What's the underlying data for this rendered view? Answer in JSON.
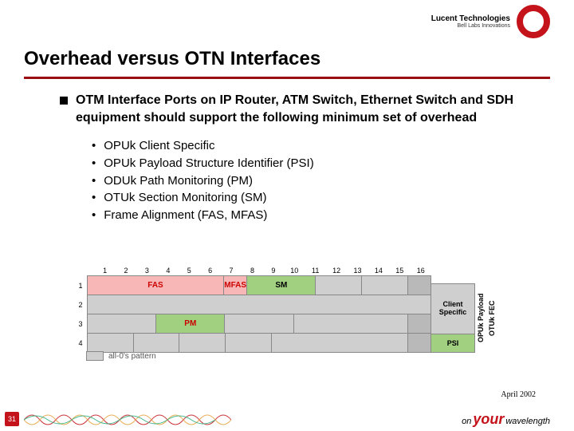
{
  "brand": {
    "name": "Lucent Technologies",
    "tag": "Bell Labs Innovations"
  },
  "title": "Overhead versus OTN Interfaces",
  "main_bullet": "OTM Interface Ports on IP Router, ATM Switch, Ethernet Switch and SDH equipment should support the following minimum set of overhead",
  "sub_bullets": [
    "OPUk Client Specific",
    "OPUk Payload Structure Identifier (PSI)",
    "ODUk Path Monitoring (PM)",
    "OTUk Section Monitoring (SM)",
    "Frame Alignment (FAS, MFAS)"
  ],
  "table": {
    "cols": [
      "1",
      "2",
      "3",
      "4",
      "5",
      "6",
      "7",
      "8",
      "9",
      "10",
      "11",
      "12",
      "13",
      "14",
      "15",
      "16"
    ],
    "rows": [
      "1",
      "2",
      "3",
      "4"
    ],
    "labels": {
      "fas": "FAS",
      "mfas": "MFAS",
      "sm": "SM",
      "pm": "PM",
      "client": "Client Specific",
      "psi": "PSI",
      "opuk": "OPUk Payload",
      "fec": "OTUk FEC"
    },
    "legend": "all-0's pattern"
  },
  "footer": {
    "date": "April 2002",
    "page": "31",
    "tagline": {
      "a": "on",
      "b": "your",
      "c": "wavelength"
    }
  }
}
